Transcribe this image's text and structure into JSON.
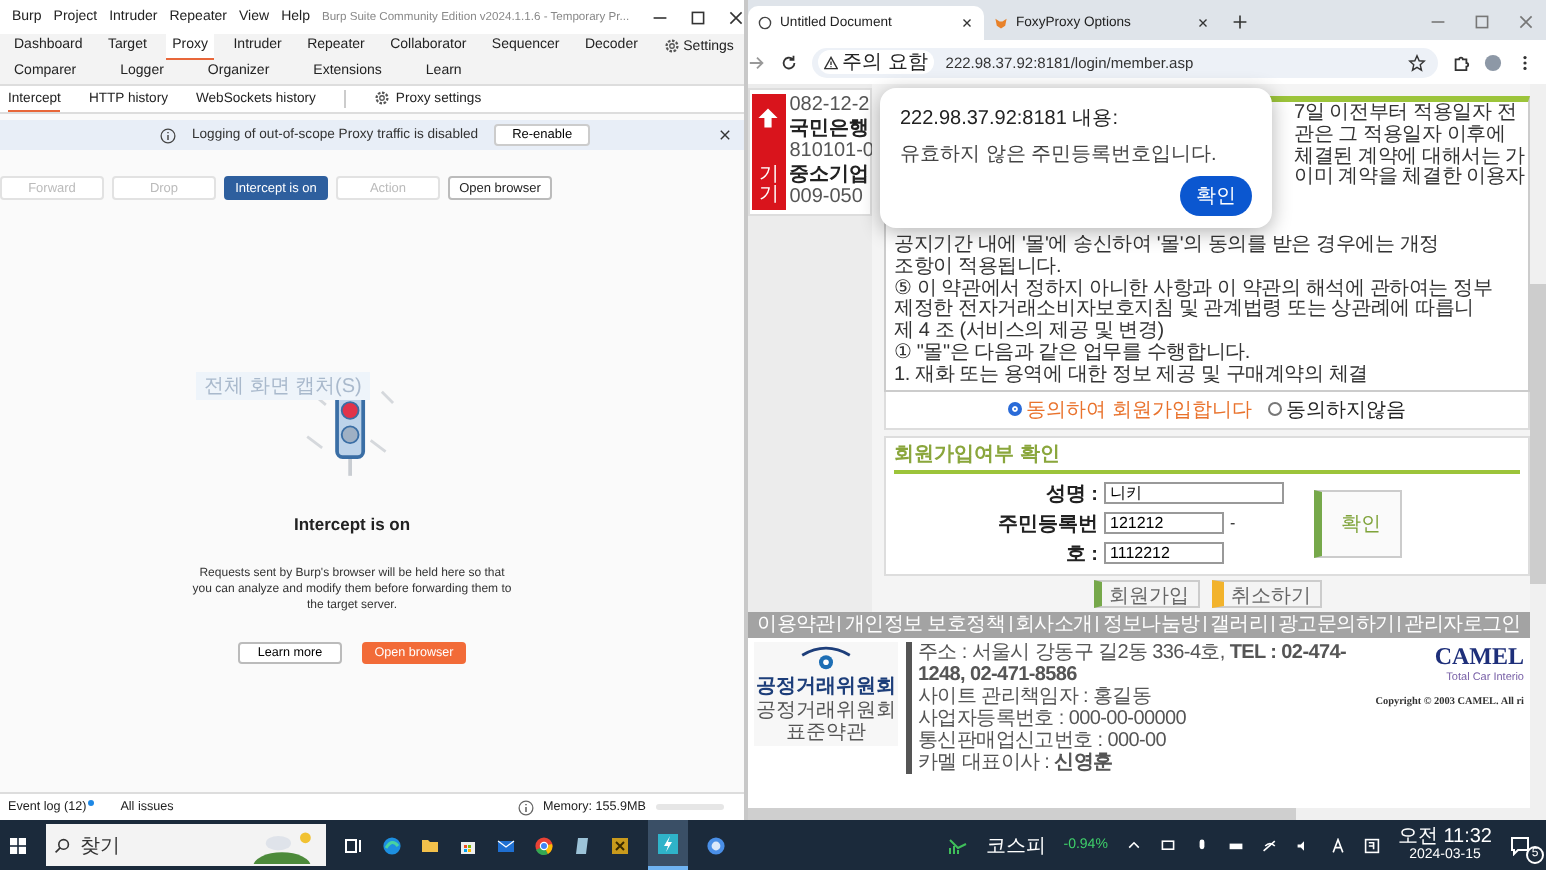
{
  "burp": {
    "menu": [
      "Burp",
      "Project",
      "Intruder",
      "Repeater",
      "View",
      "Help"
    ],
    "title": "Burp Suite Community Edition v2024.1.1.6 - Temporary Pr...",
    "main_tabs": [
      {
        "label": "Dashboard",
        "selected": false
      },
      {
        "label": "Target",
        "selected": false
      },
      {
        "label": "Proxy",
        "selected": true
      },
      {
        "label": "Intruder",
        "selected": false
      },
      {
        "label": "Repeater",
        "selected": false
      },
      {
        "label": "Collaborator",
        "selected": false
      },
      {
        "label": "Sequencer",
        "selected": false
      },
      {
        "label": "Decoder",
        "selected": false
      }
    ],
    "settings": "Settings",
    "main_tabs_row2": [
      {
        "label": "Comparer",
        "selected": false
      },
      {
        "label": "Logger",
        "selected": false
      },
      {
        "label": "Organizer",
        "selected": false
      },
      {
        "label": "Extensions",
        "selected": false
      },
      {
        "label": "Learn",
        "selected": false
      }
    ],
    "sub_tabs": [
      {
        "label": "Intercept",
        "selected": true
      },
      {
        "label": "HTTP history",
        "selected": false
      },
      {
        "label": "WebSockets history",
        "selected": false
      }
    ],
    "proxy_settings": "Proxy settings",
    "notice": {
      "text": "Logging of out-of-scope Proxy traffic is disabled",
      "button": "Re-enable"
    },
    "actions": [
      {
        "label": "Forward",
        "kind": "button",
        "disabled": true
      },
      {
        "label": "Drop",
        "kind": "button",
        "disabled": true
      },
      {
        "label": "Intercept is on",
        "kind": "toggle",
        "disabled": false
      },
      {
        "label": "Action",
        "kind": "button",
        "disabled": true
      },
      {
        "label": "Open browser",
        "kind": "button",
        "disabled": false
      }
    ],
    "tooltip": "전체 화면 캡처(S)",
    "heading": "Intercept is on",
    "description": "Requests sent by Burp's browser will be held here so that you can analyze and modify them before forwarding them to the target server.",
    "buttons": [
      {
        "label": "Learn more",
        "kind": "secondary"
      },
      {
        "label": "Open browser",
        "kind": "primary"
      }
    ],
    "status_bar": {
      "event_log": "Event log (12)",
      "all_issues": "All issues",
      "memory": "Memory: 155.9MB"
    }
  },
  "browser": {
    "tabs": [
      {
        "label": "Untitled Document",
        "selected": true
      },
      {
        "label": "FoxyProxy Options",
        "selected": false
      }
    ],
    "security_label": "주의 요함",
    "url": "222.98.37.92:8181/login/member.asp",
    "sidebar": {
      "button": "기기",
      "lines": [
        "082-12-2",
        "국민은행",
        "810101-0",
        "중소기업",
        "009-050"
      ]
    },
    "terms_fragments": [
      "7일 이전부터 적용일자 전",
      "관은 그 적용일자 이후에",
      "체결된 계약에 대해서는 가",
      "이미 계약을 체결한 이용자"
    ],
    "terms_lines": [
      "공지기간 내에 '몰'에 송신하여 '몰'의 동의를 받은 경우에는 개정",
      "조항이 적용됩니다.",
      "⑤ 이 약관에서 정하지 아니한 사항과 이 약관의 해석에 관하여는 정부",
      "제정한 전자거래소비자보호지침 및 관계법령 또는 상관례에 따릅니",
      "제 4 조 (서비스의 제공 및 변경)",
      "① \"몰\"은 다음과 같은 업무를 수행합니다.",
      "1. 재화 또는 용역에 대한 정보 제공 및 구매계약의 체결"
    ],
    "agree_options": [
      {
        "label": "동의하여 회원가입합니다",
        "selected": true
      },
      {
        "label": "동의하지않음",
        "selected": false
      }
    ],
    "member_check": {
      "title": "회원가입여부 확인",
      "name_label": "성명 :",
      "name_value": "니키",
      "id_label": "주민등록번",
      "id_label_2": "호 :",
      "id_first": "121212",
      "id_separator": "-",
      "id_second": "1112212",
      "confirm": "확인"
    },
    "buttons": [
      {
        "label": "회원가입",
        "kind": "join"
      },
      {
        "label": "취소하기",
        "kind": "cancel"
      }
    ],
    "footer_links": [
      "이용약관",
      "개인정보 보호정책",
      "회사소개",
      "정보나눔방",
      "갤러리",
      "광고문의하기",
      "관리자로그인"
    ],
    "footer": {
      "org_name": "공정거래위원회",
      "org_caption": "공정거래위원회 표준약관",
      "info": [
        "주소 : 서울시 강동구 길2동 336-4호, **TEL : 02-474-1248, 02-471-8586**",
        "사이트 관리책임자 : 홍길동",
        "사업자등록번호 : 000-00-00000",
        "통신판매업신고번호 : 000-00",
        "카멜 대표이사 : **신영훈**"
      ],
      "brand": "CAMEL",
      "brand_caption": "Total Car Interio",
      "copyright": "Copyright © 2003 CAMEL. All ri"
    }
  },
  "dialog": {
    "title": "222.98.37.92:8181 내용:",
    "message": "유효하지 않은 주민등록번호입니다.",
    "button": "확인"
  },
  "taskbar": {
    "search_placeholder": "찾기",
    "stock_name": "코스피",
    "stock_change": "-0.94%",
    "time": "오전 11:32",
    "date": "2024-03-15",
    "notifications": "5"
  }
}
